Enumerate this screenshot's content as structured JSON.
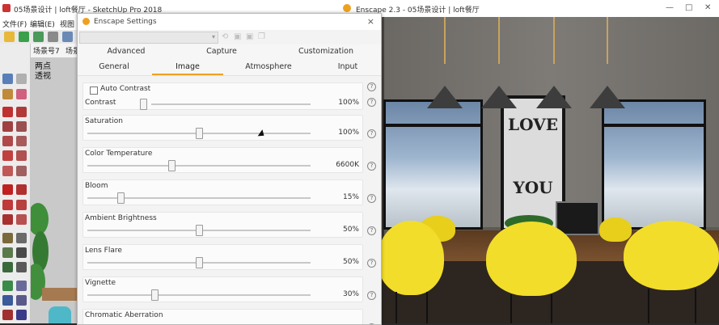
{
  "sketchup": {
    "title": "05场景设计 | loft餐厅 - SketchUp Pro 2018",
    "menu": [
      "文件(F)",
      "编辑(E)",
      "视图"
    ],
    "scene_tabs": [
      "场景号7",
      "场景"
    ],
    "viewport_label_line1": "两点",
    "viewport_label_line2": "透视"
  },
  "enscape": {
    "title": "Enscape 2.3 - 05场景设计 | loft餐厅",
    "poster_top": "LOVE",
    "poster_bottom": "YOU"
  },
  "dialog": {
    "title": "Enscape Settings",
    "close_glyph": "×",
    "tabs_row1": [
      "Advanced",
      "Capture",
      "Customization"
    ],
    "tabs_row2": [
      "General",
      "Image",
      "Atmosphere",
      "Input"
    ],
    "active_tab": "Image",
    "help_glyph": "?",
    "auto_contrast_label": "Auto Contrast",
    "auto_contrast_checked": false,
    "settings": [
      {
        "label": "Contrast",
        "value": "100%",
        "level": 0.25
      },
      {
        "label": "Saturation",
        "value": "100%",
        "level": 0.5
      },
      {
        "label": "Color Temperature",
        "value": "6600K",
        "level": 0.375
      },
      {
        "label": "Bloom",
        "value": "15%",
        "level": 0.15
      },
      {
        "label": "Ambient Brightness",
        "value": "50%",
        "level": 0.5
      },
      {
        "label": "Lens Flare",
        "value": "50%",
        "level": 0.5
      },
      {
        "label": "Vignette",
        "value": "30%",
        "level": 0.3
      },
      {
        "label": "Chromatic Aberration",
        "value": "",
        "level": 0
      }
    ]
  },
  "colors": {
    "accent": "#f0a020",
    "chair_yellow": "#f2dd2b"
  }
}
